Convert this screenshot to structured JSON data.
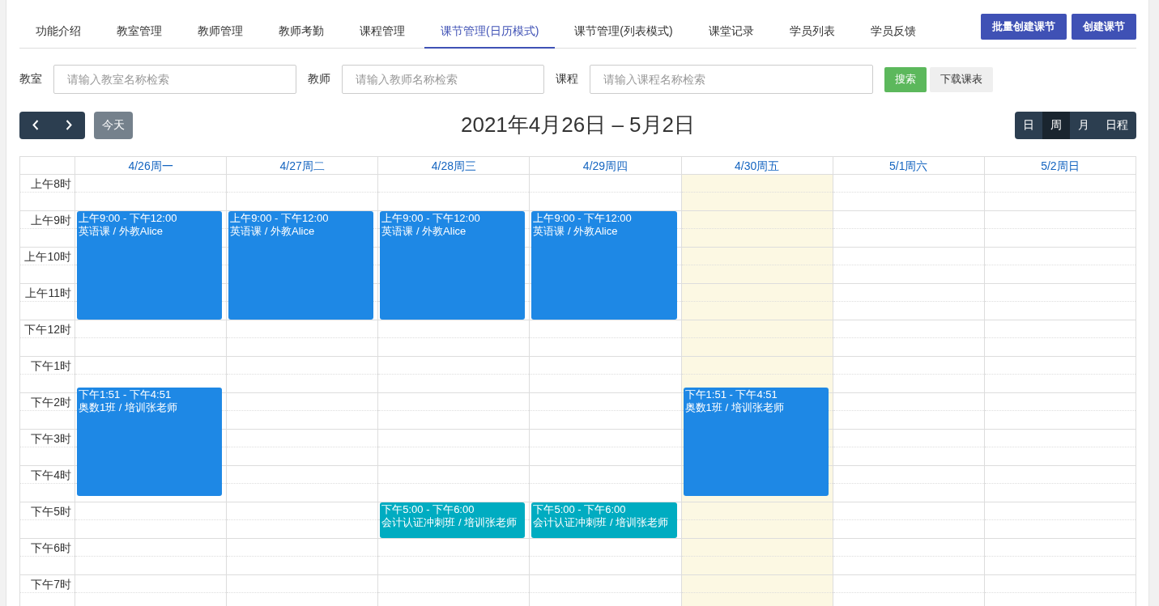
{
  "nav": {
    "tabs": [
      {
        "label": "功能介绍",
        "selected": false
      },
      {
        "label": "教室管理",
        "selected": false
      },
      {
        "label": "教师管理",
        "selected": false
      },
      {
        "label": "教师考勤",
        "selected": false
      },
      {
        "label": "课程管理",
        "selected": false
      },
      {
        "label": "课节管理(日历模式)",
        "selected": true
      },
      {
        "label": "课节管理(列表模式)",
        "selected": false
      },
      {
        "label": "课堂记录",
        "selected": false
      },
      {
        "label": "学员列表",
        "selected": false
      },
      {
        "label": "学员反馈",
        "selected": false
      }
    ],
    "buttons": [
      "批量创建课节",
      "创建课节"
    ]
  },
  "filters": {
    "fields": [
      {
        "label": "教室",
        "placeholder": "请输入教室名称检索"
      },
      {
        "label": "教师",
        "placeholder": "请输入教师名称检索"
      },
      {
        "label": "课程",
        "placeholder": "请输入课程名称检索"
      }
    ],
    "buttons": [
      {
        "label": "搜索",
        "kind": "primary"
      },
      {
        "label": "下载课表",
        "kind": "default"
      }
    ]
  },
  "toolbar": {
    "today_button": {
      "label": "今天",
      "disabled": true
    },
    "title": "2021年4月26日 – 5月2日",
    "views": [
      {
        "label": "日",
        "selected": false
      },
      {
        "label": "周",
        "selected": true
      },
      {
        "label": "月",
        "selected": false
      },
      {
        "label": "日程",
        "selected": false
      }
    ]
  },
  "calendar": {
    "hours": [
      "上午8时",
      "上午9时",
      "上午10时",
      "上午11时",
      "下午12时",
      "下午1时",
      "下午2时",
      "下午3时",
      "下午4时",
      "下午5时",
      "下午6时",
      "下午7时"
    ],
    "days": [
      {
        "label": "4/26周一",
        "today": false,
        "events": [
          {
            "time": "上午9:00 - 下午12:00",
            "title": "英语课 / 外教Alice",
            "color": "#1e88e5"
          },
          {
            "time": "下午1:51 - 下午4:51",
            "title": "奥数1班 / 培训张老师",
            "color": "#1e88e5"
          }
        ]
      },
      {
        "label": "4/27周二",
        "today": false,
        "events": [
          {
            "time": "上午9:00 - 下午12:00",
            "title": "英语课 / 外教Alice",
            "color": "#1e88e5"
          }
        ]
      },
      {
        "label": "4/28周三",
        "today": false,
        "events": [
          {
            "time": "上午9:00 - 下午12:00",
            "title": "英语课 / 外教Alice",
            "color": "#1e88e5"
          },
          {
            "time": "下午5:00 - 下午6:00",
            "title": "会计认证冲刺班 / 培训张老师",
            "color": "#00acc1"
          }
        ]
      },
      {
        "label": "4/29周四",
        "today": false,
        "events": [
          {
            "time": "上午9:00 - 下午12:00",
            "title": "英语课 / 外教Alice",
            "color": "#1e88e5"
          },
          {
            "time": "下午5:00 - 下午6:00",
            "title": "会计认证冲刺班 / 培训张老师",
            "color": "#00acc1"
          }
        ]
      },
      {
        "label": "4/30周五",
        "today": true,
        "events": [
          {
            "time": "下午1:51 - 下午4:51",
            "title": "奥数1班 / 培训张老师",
            "color": "#1e88e5"
          }
        ]
      },
      {
        "label": "5/1周六",
        "today": false
      },
      {
        "label": "5/2周日",
        "today": false
      }
    ]
  }
}
